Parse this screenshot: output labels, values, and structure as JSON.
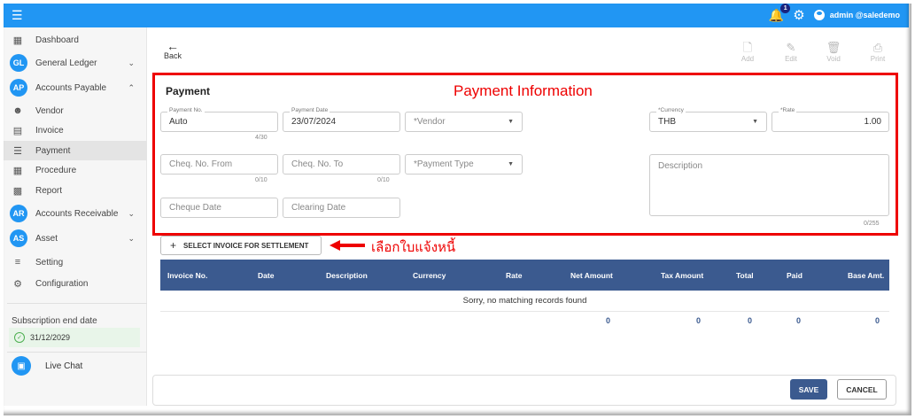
{
  "topbar": {
    "notif_count": "1",
    "user": "admin @saledemo"
  },
  "sidebar": {
    "dashboard": "Dashboard",
    "gl": {
      "abbr": "GL",
      "label": "General Ledger"
    },
    "ap": {
      "abbr": "AP",
      "label": "Accounts Payable"
    },
    "vendor": "Vendor",
    "invoice": "Invoice",
    "payment": "Payment",
    "procedure": "Procedure",
    "report": "Report",
    "ar": {
      "abbr": "AR",
      "label": "Accounts Receivable"
    },
    "asset": {
      "abbr": "AS",
      "label": "Asset"
    },
    "setting": "Setting",
    "configuration": "Configuration",
    "subscription_label": "Subscription end date",
    "subscription_date": "31/12/2029",
    "live_chat": "Live Chat"
  },
  "toolbar": {
    "back": "Back",
    "add": "Add",
    "edit": "Edit",
    "void": "Void",
    "print": "Print"
  },
  "form": {
    "title": "Payment",
    "annotation": "Payment Information",
    "payment_no": {
      "label": "Payment No.",
      "value": "Auto",
      "counter": "4/30"
    },
    "payment_date": {
      "label": "Payment Date",
      "value": "23/07/2024"
    },
    "vendor": {
      "placeholder": "*Vendor"
    },
    "currency": {
      "label": "*Currency",
      "value": "THB"
    },
    "rate": {
      "label": "*Rate",
      "value": "1.00"
    },
    "cheq_from": {
      "placeholder": "Cheq. No. From",
      "counter": "0/10"
    },
    "cheq_to": {
      "placeholder": "Cheq. No. To",
      "counter": "0/10"
    },
    "payment_type": {
      "placeholder": "*Payment Type"
    },
    "description": {
      "placeholder": "Description",
      "counter": "0/255"
    },
    "cheque_date": {
      "placeholder": "Cheque Date"
    },
    "clearing_date": {
      "placeholder": "Clearing Date"
    }
  },
  "select_invoice": {
    "label": "SELECT INVOICE FOR SETTLEMENT",
    "annotation": "เลือกใบแจ้งหนี้"
  },
  "table": {
    "columns": [
      "Invoice No.",
      "Date",
      "Description",
      "Currency",
      "Rate",
      "Net Amount",
      "Tax Amount",
      "Total",
      "Paid",
      "Base Amt."
    ],
    "empty_message": "Sorry, no matching records found",
    "totals": {
      "net_amount": "0",
      "tax_amount": "0",
      "total": "0",
      "paid": "0",
      "base_amt": "0"
    }
  },
  "footer": {
    "save": "SAVE",
    "cancel": "CANCEL"
  },
  "colors": {
    "primary": "#2196f3",
    "header": "#3b5a8f",
    "annotation": "#e00000"
  }
}
